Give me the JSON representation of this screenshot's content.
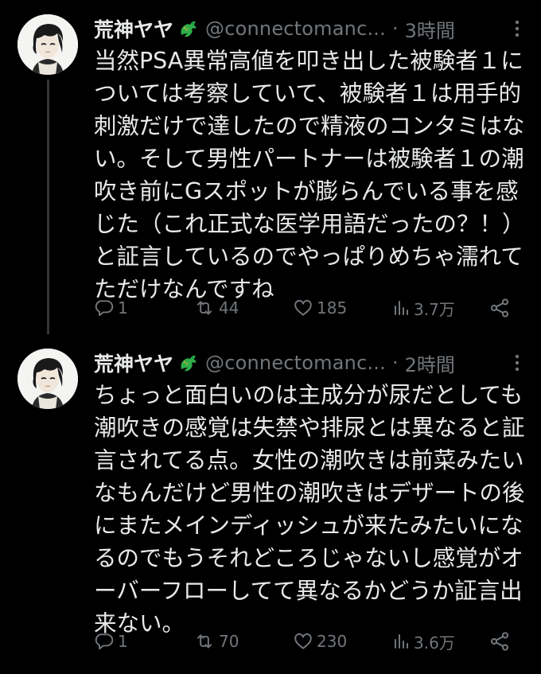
{
  "tweets": [
    {
      "author": {
        "display_name": "荒神ヤヤ",
        "badge_icon": "dragon-emoji",
        "handle": "@connectomanc...",
        "avatar_icon": "anime-avatar"
      },
      "separator": "·",
      "time": "3時間",
      "text": "当然PSA異常高値を叩き出した被験者１に\nついては考察していて、被験者１は用手的\n刺激だけで達したので精液のコンタミはな\nい。そして男性パートナーは被験者１の潮\n吹き前にGスポットが膨らんでいる事を感\nじた（これ正式な医学用語だったの？！）\nと証言しているのでやっぱりめちゃ濡れて\nただけなんですね",
      "stats": {
        "replies": "1",
        "retweets": "44",
        "likes": "185",
        "views": "3.7万"
      }
    },
    {
      "author": {
        "display_name": "荒神ヤヤ",
        "badge_icon": "dragon-emoji",
        "handle": "@connectomanc...",
        "avatar_icon": "anime-avatar"
      },
      "separator": "·",
      "time": "2時間",
      "text": "ちょっと面白いのは主成分が尿だとしても\n潮吹きの感覚は失禁や排尿とは異なると証\n言されてる点。女性の潮吹きは前菜みたい\nなもんだけど男性の潮吹きはデザートの後\nにまたメインディッシュが来たみたいにな\nるのでもうそれどころじゃないし感覚がオ\nーバーフローしてて異なるかどうか証言出\n来ない。",
      "stats": {
        "replies": "1",
        "retweets": "70",
        "likes": "230",
        "views": "3.6万"
      }
    }
  ],
  "colors": {
    "background": "#000000",
    "text_primary": "#e7e9ea",
    "text_secondary": "#71767b",
    "thread_line": "#333639",
    "badge_green": "#2fae4a"
  },
  "icons": {
    "more": "more-dots-icon",
    "reply": "reply-icon",
    "retweet": "retweet-icon",
    "like": "heart-icon",
    "views": "views-chart-icon",
    "share": "share-icon"
  }
}
